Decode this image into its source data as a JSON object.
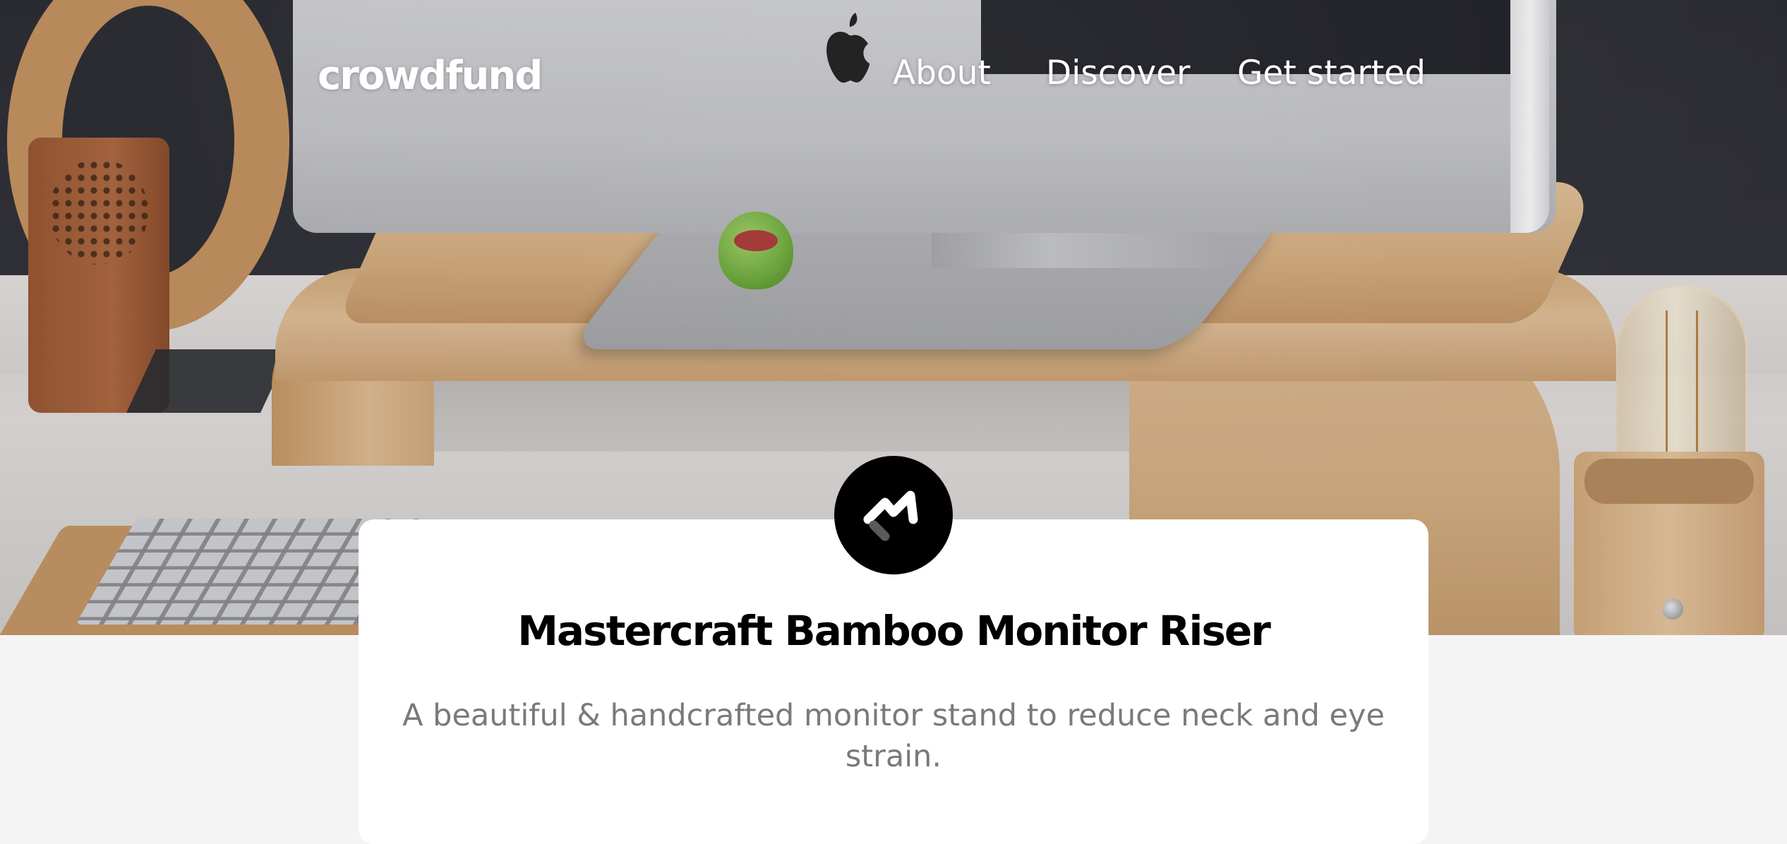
{
  "brand": {
    "name": "crowdfund"
  },
  "nav": {
    "items": [
      {
        "label": "About"
      },
      {
        "label": "Discover"
      },
      {
        "label": "Get started"
      }
    ]
  },
  "hero": {
    "image_subject": "monitor-riser-desk-photo"
  },
  "project": {
    "badge_icon": "mastercraft-logo-icon",
    "title": "Mastercraft Bamboo Monitor Riser",
    "description": "A beautiful & handcrafted monitor stand to reduce neck and eye strain."
  },
  "colors": {
    "page_background": "#f4f4f4",
    "card_background": "#ffffff",
    "title_text": "#000000",
    "description_text": "#7a7a7a",
    "nav_text": "#ffffff"
  }
}
